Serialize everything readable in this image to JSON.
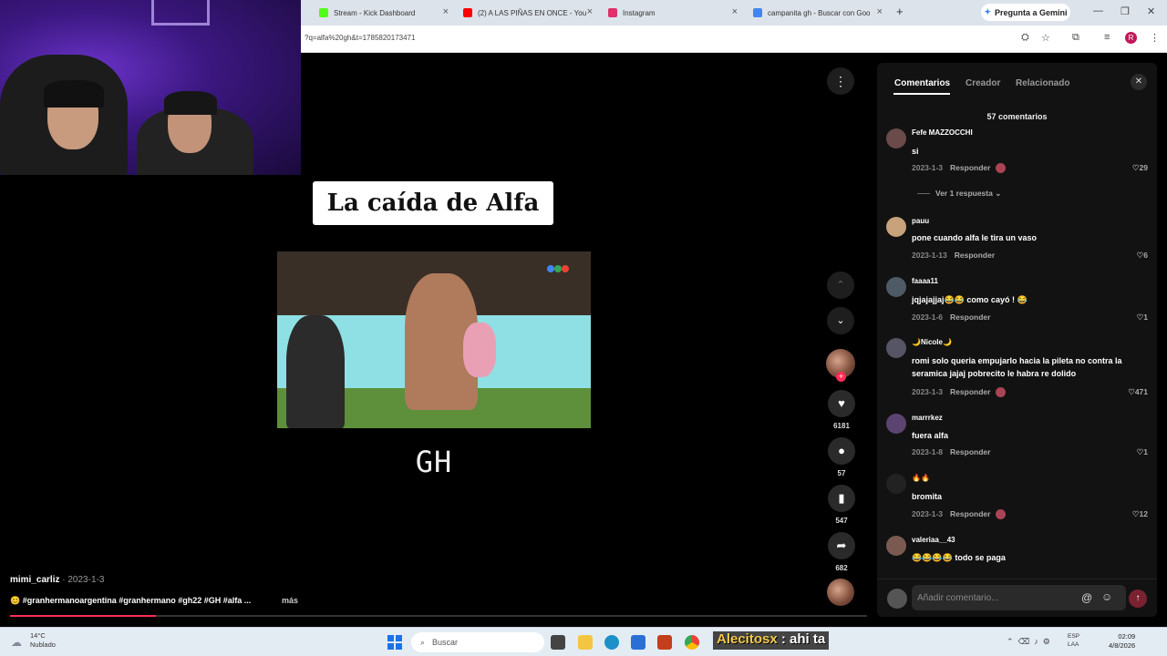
{
  "browser": {
    "tabs": [
      {
        "title": "Stream - Kick Dashboard",
        "favicon_color": "#53fc18"
      },
      {
        "title": "(2) A LAS PIÑAS EN ONCE - You",
        "favicon_color": "#ff0000"
      },
      {
        "title": "Instagram",
        "favicon_color": "#e1306c"
      },
      {
        "title": "campanita gh - Buscar con Goo",
        "favicon_color": "#4285f4"
      }
    ],
    "new_tab_label": "+",
    "gemini_label": "Pregunta a Gemini",
    "url": "?q=alfa%20gh&t=1785820173471",
    "profile_initial": "R"
  },
  "video": {
    "title": "La caída de Alfa",
    "caption": "GH",
    "more_icon": "⋮",
    "author": "mimi_carliz",
    "date": " · 2023-1-3",
    "description": "😊 #granhermanoargentina #granhermano #gh22 #GH #alfa ...",
    "more_label": "más",
    "progress": 0.17
  },
  "actions": {
    "likes": "6181",
    "comments": "57",
    "saves": "547",
    "shares": "682"
  },
  "panel": {
    "tabs": [
      "Comentarios",
      "Creador",
      "Relacionado"
    ],
    "comment_count": "57 comentarios",
    "view_replies": "Ver 1 respuesta",
    "input_placeholder": "Añadir comentario...",
    "comments": [
      {
        "user": "Fefe MAZZOCCHI",
        "text": "si",
        "date": "2023-1-3",
        "reply": "Responder",
        "likes": "29",
        "creator_liked": true
      },
      {
        "user": "pauu",
        "text": "pone cuando alfa le tira un vaso",
        "date": "2023-1-13",
        "reply": "Responder",
        "likes": "6",
        "creator_liked": false
      },
      {
        "user": "faaaa11",
        "text": "jqjajajjaj😂😂 como cayó ! 😂",
        "date": "2023-1-6",
        "reply": "Responder",
        "likes": "1",
        "creator_liked": false
      },
      {
        "user": "🌙Nicole🌙",
        "text": "romi solo queria empujarlo hacia la pileta no contra la seramica jajaj pobrecito le habra re dolido",
        "date": "2023-1-3",
        "reply": "Responder",
        "likes": "471",
        "creator_liked": true
      },
      {
        "user": "marrrkez",
        "text": "fuera alfa",
        "date": "2023-1-8",
        "reply": "Responder",
        "likes": "1",
        "creator_liked": false
      },
      {
        "user": "🔥🔥",
        "text": "bromita",
        "date": "2023-1-3",
        "reply": "Responder",
        "likes": "12",
        "creator_liked": true
      },
      {
        "user": "valeriaa__43",
        "text": "😂😂😂😂 todo se paga",
        "date": "",
        "reply": "",
        "likes": "",
        "creator_liked": false
      }
    ]
  },
  "taskbar": {
    "temp": "14°C",
    "weather": "Nublado",
    "search_label": "Buscar",
    "chat_user": "Alecitosx",
    "chat_message": " : ahi ta",
    "lang_top": "ESP",
    "lang_bottom": "LAA",
    "time": "02:09",
    "date": "4/8/2026"
  }
}
